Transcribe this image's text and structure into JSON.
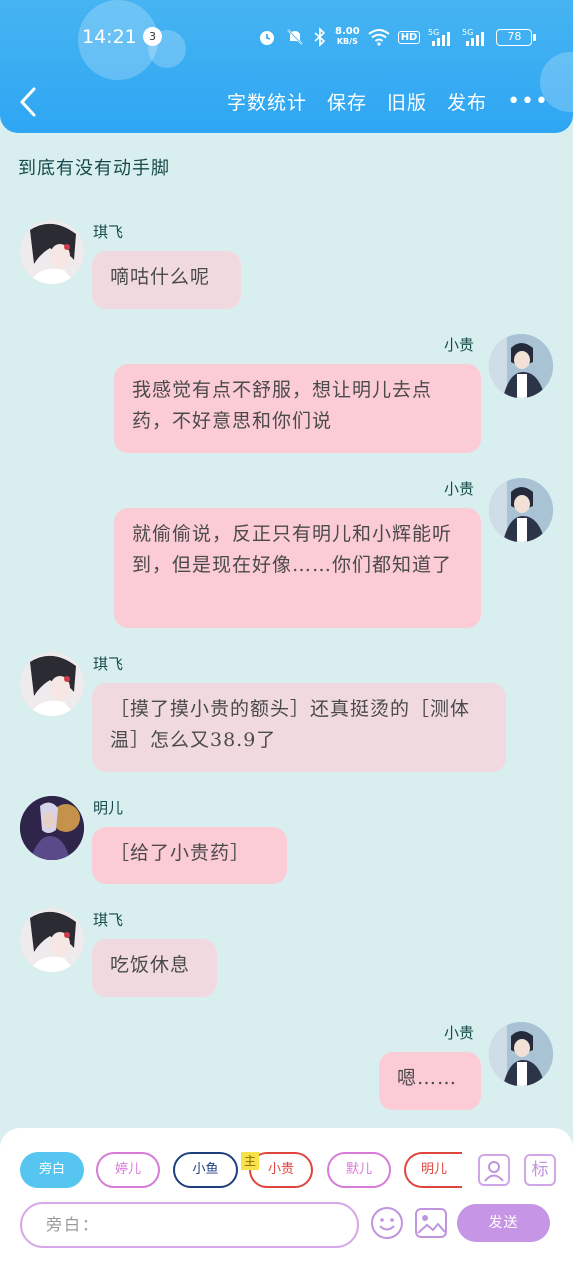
{
  "status_bar": {
    "time": "14:21",
    "notification_count": "3",
    "net_speed_value": "8.00",
    "net_speed_unit": "KB/S",
    "hd_label": "HD",
    "battery": "78"
  },
  "toolbar": {
    "word_count": "字数统计",
    "save": "保存",
    "old_version": "旧版",
    "publish": "发布",
    "more": "•••"
  },
  "chat": {
    "title": "到底有没有动手脚",
    "messages": [
      {
        "speaker": "琪飞",
        "side": "left",
        "text": "嘀咕什么呢"
      },
      {
        "speaker": "小贵",
        "side": "right",
        "text": "我感觉有点不舒服，想让明儿去点药，不好意思和你们说"
      },
      {
        "speaker": "小贵",
        "side": "right",
        "text": "就偷偷说，反正只有明儿和小辉能听到，但是现在好像……你们都知道了"
      },
      {
        "speaker": "琪飞",
        "side": "left",
        "text": "［摸了摸小贵的额头］还真挺烫的［测体温］怎么又38.9了"
      },
      {
        "speaker": "明儿",
        "side": "left",
        "text": "［给了小贵药］"
      },
      {
        "speaker": "琪飞",
        "side": "left",
        "text": "吃饭休息"
      },
      {
        "speaker": "小贵",
        "side": "right",
        "text": "嗯……"
      }
    ]
  },
  "roles": {
    "chips": [
      {
        "label": "旁白",
        "color": "#56c6f0"
      },
      {
        "label": "婷儿",
        "color": "#d77ad9"
      },
      {
        "label": "小鱼",
        "color": "#1d3f7c"
      },
      {
        "label": "小贵",
        "color": "#e0453d"
      },
      {
        "label": "默儿",
        "color": "#d77ad9"
      },
      {
        "label": "明儿",
        "color": "#e0453d"
      }
    ],
    "main_tag": "主",
    "label_icon": "标"
  },
  "composer": {
    "placeholder": "旁白：",
    "send": "发送"
  },
  "colors": {
    "header": "#2ea6f3",
    "background": "#d9efef",
    "bubble_left": "#f1dadf",
    "bubble_right": "#fcccd6",
    "send_button": "#c795e6"
  },
  "icons": [
    "back-arrow-icon",
    "more-dots-icon",
    "alarm-icon",
    "mute-icon",
    "bluetooth-icon",
    "wifi-icon",
    "signal-icon",
    "battery-icon",
    "person-card-icon",
    "smiley-icon",
    "image-icon"
  ]
}
